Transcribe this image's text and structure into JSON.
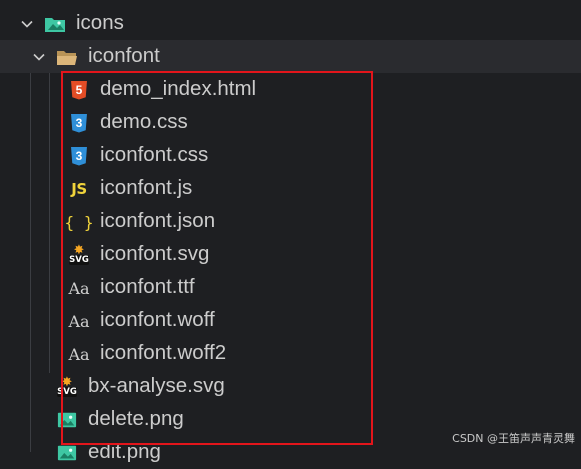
{
  "tree": {
    "folder_icons": {
      "name": "icons",
      "expanded": true
    },
    "folder_iconfont": {
      "name": "iconfont",
      "expanded": true
    },
    "iconfont_files": [
      {
        "name": "demo_index.html",
        "icon": "html5-icon"
      },
      {
        "name": "demo.css",
        "icon": "css3-icon"
      },
      {
        "name": "iconfont.css",
        "icon": "css3-icon"
      },
      {
        "name": "iconfont.js",
        "icon": "js-icon"
      },
      {
        "name": "iconfont.json",
        "icon": "json-icon"
      },
      {
        "name": "iconfont.svg",
        "icon": "svg-icon"
      },
      {
        "name": "iconfont.ttf",
        "icon": "font-icon"
      },
      {
        "name": "iconfont.woff",
        "icon": "font-icon"
      },
      {
        "name": "iconfont.woff2",
        "icon": "font-icon"
      }
    ],
    "icons_files": [
      {
        "name": "bx-analyse.svg",
        "icon": "svg-icon"
      },
      {
        "name": "delete.png",
        "icon": "image-icon"
      },
      {
        "name": "edit.png",
        "icon": "image-icon"
      }
    ],
    "icon_labels": {
      "html5": "5",
      "css3": "3",
      "js": "JS",
      "json": "{ }",
      "font": "Aa",
      "svg_tag": "SVG"
    }
  },
  "watermark": "CSDN @王笛声声青灵舞",
  "colors": {
    "background": "#1e1f22",
    "highlight_box": "#e3151b",
    "folder": "#dcb67a",
    "image": "#3ec7a3"
  }
}
